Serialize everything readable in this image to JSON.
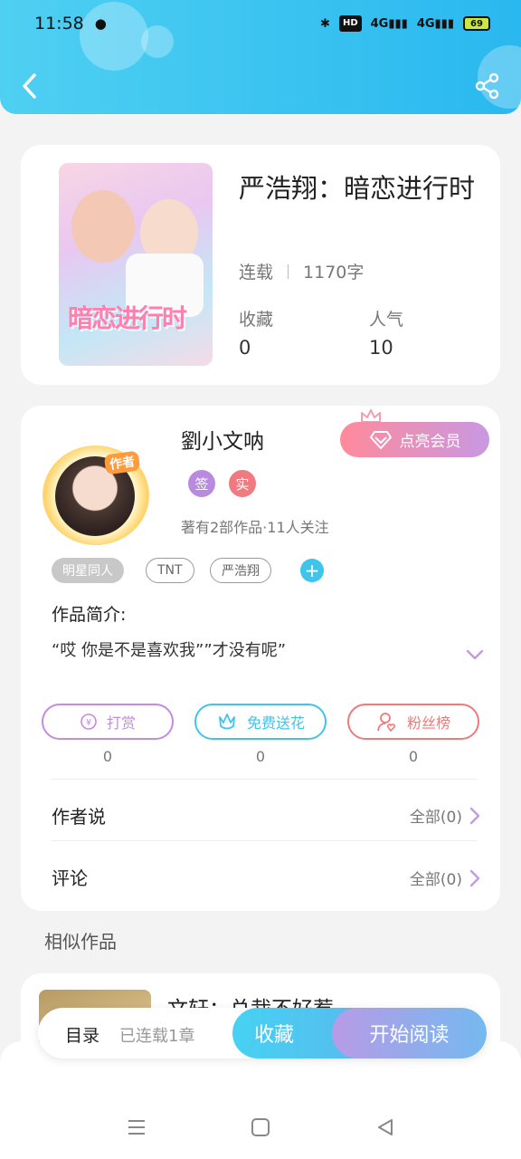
{
  "status_bar": {
    "time": "11:58",
    "battery": "69",
    "net1": "4G",
    "net2": "4G",
    "hd": "HD"
  },
  "book": {
    "title": "严浩翔：暗恋进行时",
    "cover_text": "暗恋进行时",
    "status": "连载",
    "words": "1170字",
    "favorites_label": "收藏",
    "favorites_value": "0",
    "popularity_label": "人气",
    "popularity_value": "10"
  },
  "author": {
    "name": "劉小文呐",
    "avatar_badge": "作者",
    "vip_button": "点亮会员",
    "badges": [
      "签",
      "实"
    ],
    "meta": "著有2部作品·11人关注",
    "tags": [
      "明星同人",
      "TNT",
      "严浩翔"
    ],
    "intro_label": "作品简介:",
    "intro_text": "“哎 你是不是喜欢我””才没有呢”"
  },
  "actions": [
    {
      "label": "打赏",
      "count": "0",
      "color": "#c68ae0"
    },
    {
      "label": "免费送花",
      "count": "0",
      "color": "#3fc4ec"
    },
    {
      "label": "粉丝榜",
      "count": "0",
      "color": "#f07a7a"
    }
  ],
  "rows": [
    {
      "label": "作者说",
      "right": "全部(0)"
    },
    {
      "label": "评论",
      "right": "全部(0)"
    }
  ],
  "similar": {
    "section_title": "相似作品",
    "first_title": "文轩：总裁不好惹"
  },
  "bottom_bar": {
    "toc_label": "目录",
    "toc_sub": "已连载1章",
    "fav_button": "收藏",
    "read_button": "开始阅读"
  }
}
